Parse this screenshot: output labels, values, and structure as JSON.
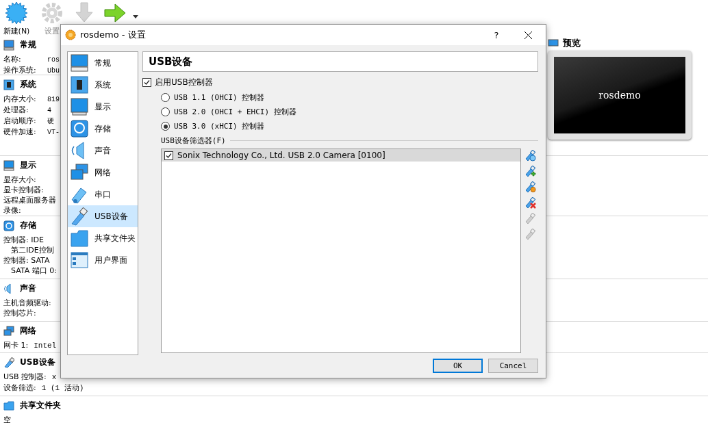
{
  "toolbar": {
    "buttons": [
      {
        "label": "新建(N)",
        "disabled": false
      },
      {
        "label": "设置",
        "disabled": true
      }
    ],
    "icon_buttons": [
      {
        "disabled": true
      },
      {
        "disabled": false
      }
    ]
  },
  "details": {
    "top_sections": [
      {
        "title": "常规",
        "rows": [
          {
            "label": "名称:",
            "value": "ros"
          },
          {
            "label": "操作系统:",
            "value": "Ubu"
          }
        ]
      },
      {
        "title": "系统",
        "rows": [
          {
            "label": "内存大小:",
            "value": "819"
          },
          {
            "label": "处理器:",
            "value": "4"
          },
          {
            "label": "启动顺序:",
            "value": "硬"
          },
          {
            "label": "硬件加速:",
            "value": "VT-"
          }
        ]
      }
    ],
    "sections": [
      {
        "title": "显示",
        "rows": [
          {
            "label": "显存大小:"
          },
          {
            "label": "显卡控制器:"
          },
          {
            "label": "远程桌面服务器"
          },
          {
            "label": "录像:"
          }
        ]
      },
      {
        "title": "存储",
        "rows": [
          {
            "label": "控制器: IDE",
            "children": [
              {
                "label": "第二IDE控制"
              }
            ]
          },
          {
            "label": "控制器: SATA",
            "children": [
              {
                "label": "SATA 端口 0:"
              }
            ]
          }
        ]
      },
      {
        "title": "声音",
        "rows": [
          {
            "label": "主机音频驱动:"
          },
          {
            "label": "控制芯片:"
          }
        ]
      },
      {
        "title": "网络",
        "rows": [
          {
            "label": "网卡 1:",
            "value": "Intel"
          }
        ]
      },
      {
        "title": "USB设备",
        "rows": [
          {
            "label": "USB 控制器:",
            "value": "x"
          },
          {
            "label": "设备筛选:",
            "value": "1 (1 活动)"
          }
        ]
      },
      {
        "title": "共享文件夹",
        "rows": [
          {
            "label": "空"
          }
        ]
      }
    ]
  },
  "preview": {
    "title": "预览",
    "screen_text": "rosdemo"
  },
  "dialog": {
    "title": "rosdemo - 设置",
    "help": "?",
    "nav": [
      {
        "label": "常规",
        "selected": false
      },
      {
        "label": "系统",
        "selected": false
      },
      {
        "label": "显示",
        "selected": false
      },
      {
        "label": "存储",
        "selected": false
      },
      {
        "label": "声音",
        "selected": false
      },
      {
        "label": "网络",
        "selected": false
      },
      {
        "label": "串口",
        "selected": false
      },
      {
        "label": "USB设备",
        "selected": true
      },
      {
        "label": "共享文件夹",
        "selected": false
      },
      {
        "label": "用户界面",
        "selected": false
      }
    ],
    "heading": "USB设备",
    "enable": {
      "label": "启用USB控制器",
      "checked": true
    },
    "controllers": [
      {
        "label": "USB 1.1 (OHCI) 控制器",
        "selected": false
      },
      {
        "label": "USB 2.0 (OHCI + EHCI) 控制器",
        "selected": false
      },
      {
        "label": "USB 3.0 (xHCI) 控制器",
        "selected": true
      }
    ],
    "filters": {
      "title": "USB设备筛选器(F)",
      "items": [
        {
          "label": "Sonix Technology Co., Ltd. USB 2.0 Camera [0100]",
          "checked": true,
          "selected": true
        }
      ],
      "tools": [
        {
          "disabled": false
        },
        {
          "disabled": false
        },
        {
          "disabled": false
        },
        {
          "disabled": false
        },
        {
          "disabled": true
        },
        {
          "disabled": true
        }
      ]
    },
    "buttons": [
      {
        "label": "OK",
        "default": true
      },
      {
        "label": "Cancel",
        "default": false
      }
    ]
  }
}
